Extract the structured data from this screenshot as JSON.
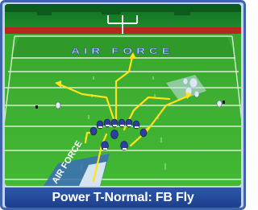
{
  "field": {
    "endzone_text": "AIR FORCE",
    "logo_text": "AIR FORCE"
  },
  "play": {
    "caption": "Power T-Normal: FB Fly"
  },
  "colors": {
    "frame": "#3d64ad",
    "caption_bg": "#1d3f8c",
    "route": "#ffe21a",
    "turf": "#3aa42b"
  }
}
